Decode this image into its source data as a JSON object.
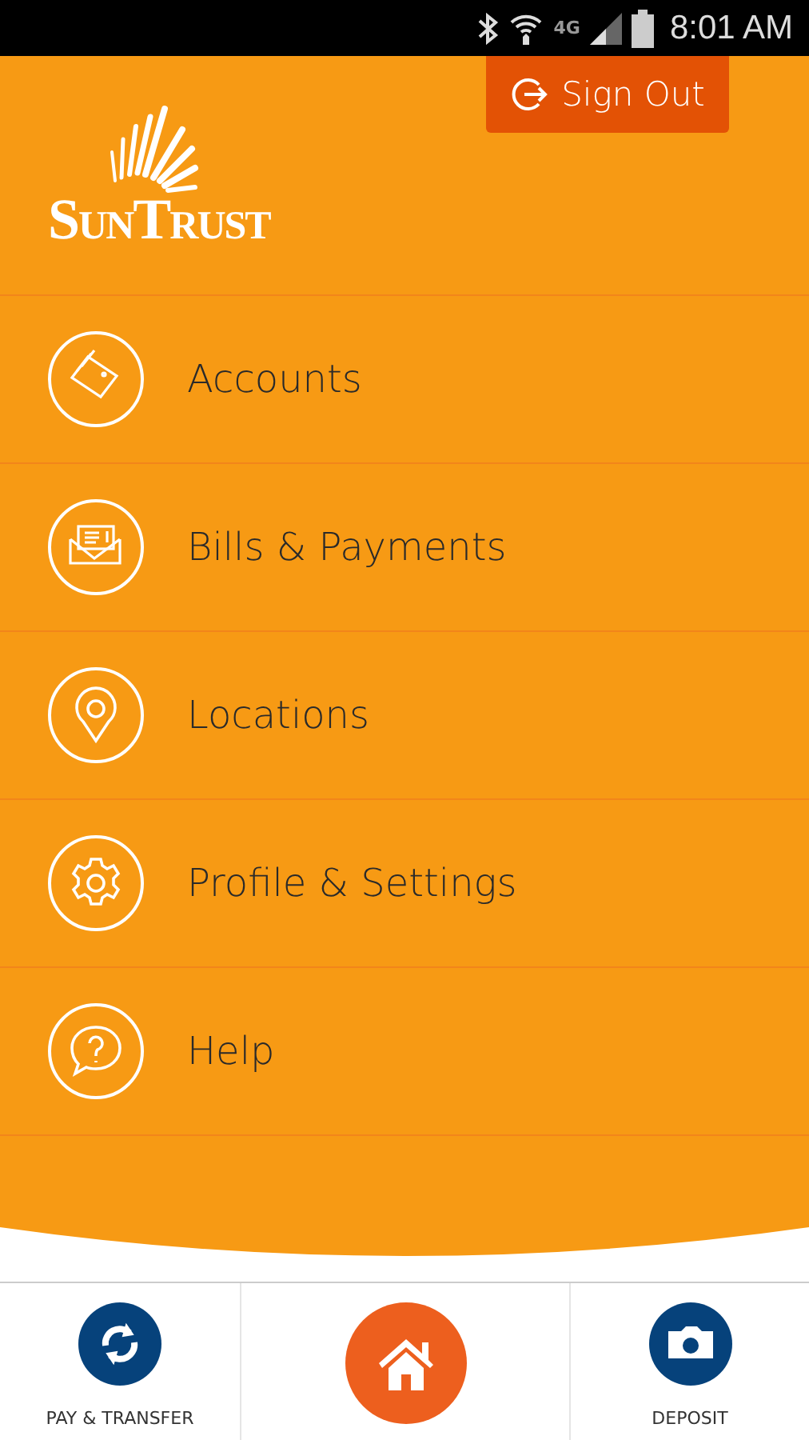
{
  "status_bar": {
    "network": "4G",
    "time": "8:01 AM"
  },
  "header": {
    "sign_out": "Sign Out",
    "logo": "SunTrust"
  },
  "menu": [
    {
      "label": "Accounts"
    },
    {
      "label": "Bills & Payments"
    },
    {
      "label": "Locations"
    },
    {
      "label": "Profile & Settings"
    },
    {
      "label": "Help"
    }
  ],
  "bottom_nav": [
    {
      "kind": "transfer",
      "label": "PAY & TRANSFER"
    },
    {
      "kind": "home"
    },
    {
      "kind": "deposit",
      "label": "DEPOSIT"
    }
  ]
}
